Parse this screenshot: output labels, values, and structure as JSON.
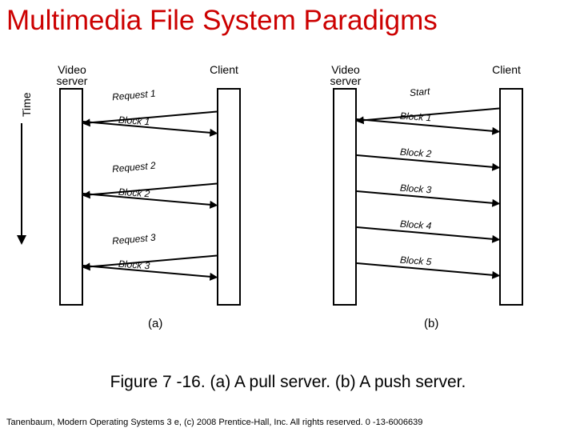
{
  "title": "Multimedia File System Paradigms",
  "axis": "Time",
  "labels": {
    "video_server": "Video\nserver",
    "client": "Client"
  },
  "a": [
    "Request 1",
    "Block 1",
    "Request 2",
    "Block 2",
    "Request 3",
    "Block 3"
  ],
  "b": [
    "Start",
    "Block 1",
    "Block 2",
    "Block 3",
    "Block 4",
    "Block 5"
  ],
  "sub": {
    "a": "(a)",
    "b": "(b)"
  },
  "caption": "Figure 7 -16. (a) A pull server. (b) A push server.",
  "footer": "Tanenbaum, Modern Operating Systems 3 e, (c) 2008 Prentice-Hall, Inc. All rights reserved. 0 -13-6006639",
  "chart_data": {
    "type": "sequence-diagram",
    "actors": [
      "Video server",
      "Client"
    ],
    "panels": [
      {
        "id": "a",
        "label": "Pull server",
        "messages": [
          {
            "from": "Client",
            "to": "Video server",
            "text": "Request 1"
          },
          {
            "from": "Video server",
            "to": "Client",
            "text": "Block 1"
          },
          {
            "from": "Client",
            "to": "Video server",
            "text": "Request 2"
          },
          {
            "from": "Video server",
            "to": "Client",
            "text": "Block 2"
          },
          {
            "from": "Client",
            "to": "Video server",
            "text": "Request 3"
          },
          {
            "from": "Video server",
            "to": "Client",
            "text": "Block 3"
          }
        ]
      },
      {
        "id": "b",
        "label": "Push server",
        "messages": [
          {
            "from": "Client",
            "to": "Video server",
            "text": "Start"
          },
          {
            "from": "Video server",
            "to": "Client",
            "text": "Block 1"
          },
          {
            "from": "Video server",
            "to": "Client",
            "text": "Block 2"
          },
          {
            "from": "Video server",
            "to": "Client",
            "text": "Block 3"
          },
          {
            "from": "Video server",
            "to": "Client",
            "text": "Block 4"
          },
          {
            "from": "Video server",
            "to": "Client",
            "text": "Block 5"
          }
        ]
      }
    ]
  }
}
